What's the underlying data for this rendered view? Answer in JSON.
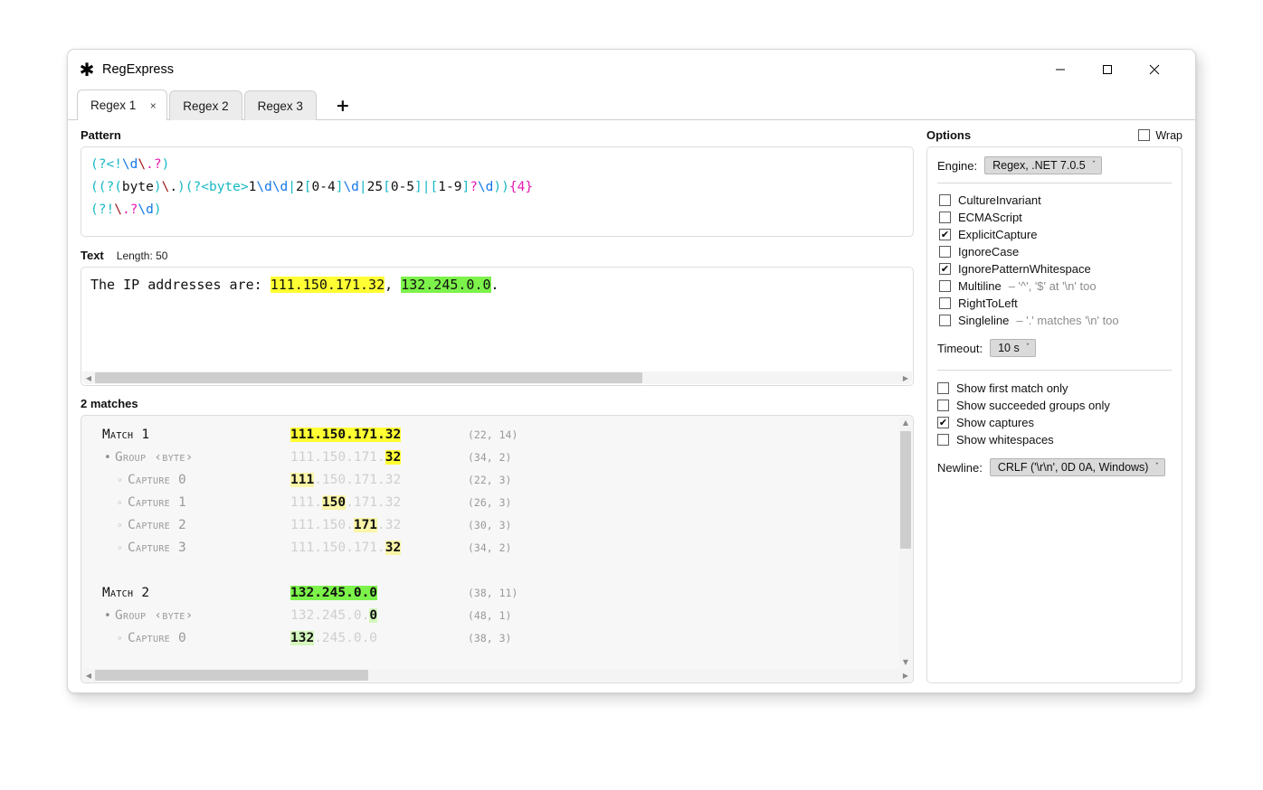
{
  "window": {
    "title": "RegExpress",
    "app_icon": "asterisk-icon",
    "minimize": "—",
    "maximize": "☐",
    "close": "✕"
  },
  "tabs": {
    "items": [
      {
        "label": "Regex 1",
        "active": true,
        "close": "×"
      },
      {
        "label": "Regex 2",
        "active": false
      },
      {
        "label": "Regex 3",
        "active": false
      }
    ],
    "add_label": "+"
  },
  "pattern": {
    "label": "Pattern",
    "lines": [
      "(?<!\\d\\.?)",
      "((?(byte)\\.)(?<byte>1\\d\\d|2[0-4]\\d|25[0-5]|[1-9]?\\d)){4}",
      "(?!\\.?\\d)"
    ]
  },
  "text": {
    "label": "Text",
    "length_label": "Length: 50",
    "prefix": "The IP addresses are: ",
    "match1": "111.150.171.32",
    "separator": ", ",
    "match2": "132.245.0.0",
    "suffix": "."
  },
  "matches": {
    "count_label": "2 matches",
    "rows": [
      {
        "kind": "Match",
        "name": "1",
        "bullet": "",
        "indent": 0,
        "value_pre": "",
        "value_hl": "111.150.171.32",
        "value_post": "",
        "hl_style": "strong-yellow",
        "pos": "(22, 14)"
      },
      {
        "kind": "Group",
        "name": "‹byte›",
        "bullet": "•",
        "indent": 1,
        "value_pre": "111.150.171.",
        "value_hl": "32",
        "value_post": "",
        "hl_style": "strong-yellow",
        "pos": "(34, 2)"
      },
      {
        "kind": "Capture",
        "name": "0",
        "bullet": "◦",
        "indent": 2,
        "value_pre": "",
        "value_hl": "111",
        "value_post": ".150.171.32",
        "hl_style": "soft-yellow",
        "pos": "(22, 3)"
      },
      {
        "kind": "Capture",
        "name": "1",
        "bullet": "◦",
        "indent": 2,
        "value_pre": "111.",
        "value_hl": "150",
        "value_post": ".171.32",
        "hl_style": "soft-yellow",
        "pos": "(26, 3)"
      },
      {
        "kind": "Capture",
        "name": "2",
        "bullet": "◦",
        "indent": 2,
        "value_pre": "111.150.",
        "value_hl": "171",
        "value_post": ".32",
        "hl_style": "soft-yellow",
        "pos": "(30, 3)"
      },
      {
        "kind": "Capture",
        "name": "3",
        "bullet": "◦",
        "indent": 2,
        "value_pre": "111.150.171.",
        "value_hl": "32",
        "value_post": "",
        "hl_style": "soft-yellow",
        "pos": "(34, 2)"
      },
      {
        "kind": "",
        "name": "",
        "bullet": "",
        "indent": 0,
        "value_pre": "",
        "value_hl": "",
        "value_post": "",
        "pos": ""
      },
      {
        "kind": "Match",
        "name": "2",
        "bullet": "",
        "indent": 0,
        "value_pre": "",
        "value_hl": "132.245.0.0",
        "value_post": "",
        "hl_style": "strong-green",
        "pos": "(38, 11)"
      },
      {
        "kind": "Group",
        "name": "‹byte›",
        "bullet": "•",
        "indent": 1,
        "value_pre": "132.245.0.",
        "value_hl": "0",
        "value_post": "",
        "hl_style": "soft-green",
        "pos": "(48, 1)"
      },
      {
        "kind": "Capture",
        "name": "0",
        "bullet": "◦",
        "indent": 2,
        "value_pre": "",
        "value_hl": "132",
        "value_post": ".245.0.0",
        "hl_style": "soft-green",
        "pos": "(38, 3)"
      }
    ]
  },
  "options": {
    "title": "Options",
    "wrap_label": "Wrap",
    "wrap_checked": false,
    "engine_label": "Engine:",
    "engine_value": "Regex, .NET 7.0.5",
    "flags": [
      {
        "label": "CultureInvariant",
        "checked": false,
        "hint": ""
      },
      {
        "label": "ECMAScript",
        "checked": false,
        "hint": ""
      },
      {
        "label": "ExplicitCapture",
        "checked": true,
        "hint": ""
      },
      {
        "label": "IgnoreCase",
        "checked": false,
        "hint": ""
      },
      {
        "label": "IgnorePatternWhitespace",
        "checked": true,
        "hint": ""
      },
      {
        "label": "Multiline",
        "checked": false,
        "hint": "– '^', '$' at '\\n' too"
      },
      {
        "label": "RightToLeft",
        "checked": false,
        "hint": ""
      },
      {
        "label": "Singleline",
        "checked": false,
        "hint": "– '.' matches '\\n' too"
      }
    ],
    "timeout_label": "Timeout:",
    "timeout_value": "10 s",
    "display": [
      {
        "label": "Show first match only",
        "checked": false
      },
      {
        "label": "Show succeeded groups only",
        "checked": false
      },
      {
        "label": "Show captures",
        "checked": true
      },
      {
        "label": "Show whitespaces",
        "checked": false
      }
    ],
    "newline_label": "Newline:",
    "newline_value": "CRLF ('\\r\\n', 0D 0A, Windows)",
    "checkmark": "✔",
    "chevron": "ˇ"
  },
  "colors": {
    "match_yellow": "#ffff33",
    "match_green": "#7cf24a",
    "capture_yellow": "#faf5a8",
    "capture_green": "#d4f7bd",
    "syntax_group": "#17b8c4",
    "syntax_escape": "#1478e8",
    "syntax_backslash": "#a01818",
    "syntax_quantifier": "#e61ab2"
  }
}
